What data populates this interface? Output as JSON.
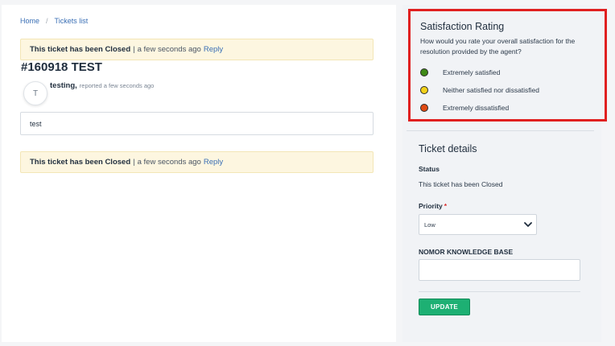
{
  "breadcrumb": {
    "home": "Home",
    "separator": "/",
    "current": "Tickets list"
  },
  "alerts": [
    {
      "message": "This ticket has been Closed",
      "separator": "|",
      "time": "a few seconds ago",
      "reply": "Reply"
    },
    {
      "message": "This ticket has been Closed",
      "separator": "|",
      "time": "a few seconds ago",
      "reply": "Reply"
    }
  ],
  "ticket": {
    "title": "#160918 TEST",
    "avatar_initial": "T",
    "author": "testing,",
    "meta": "reported a few seconds ago",
    "message": "test"
  },
  "satisfaction": {
    "title": "Satisfaction Rating",
    "question": "How would you rate your overall satisfaction for the resolution provided by the agent?",
    "options": [
      {
        "label": "Extremely satisfied",
        "color": "#3f8a17"
      },
      {
        "label": "Neither satisfied nor dissatisfied",
        "color": "#f2d11a"
      },
      {
        "label": "Extremely dissatisfied",
        "color": "#e04b14"
      }
    ]
  },
  "details": {
    "title": "Ticket details",
    "status_label": "Status",
    "status_value": "This ticket has been Closed",
    "priority_label": "Priority",
    "priority_required": "*",
    "priority_value": "Low",
    "kb_label": "NOMOR KNOWLEDGE BASE",
    "kb_value": "",
    "update_button": "UPDATE"
  },
  "colors": {
    "accent": "#1db073",
    "link": "#3a6fb5",
    "highlight_border": "#e02020",
    "alert_bg": "#fdf6e0"
  },
  "icons": {
    "priority_dropdown": "chevron-down-icon"
  }
}
